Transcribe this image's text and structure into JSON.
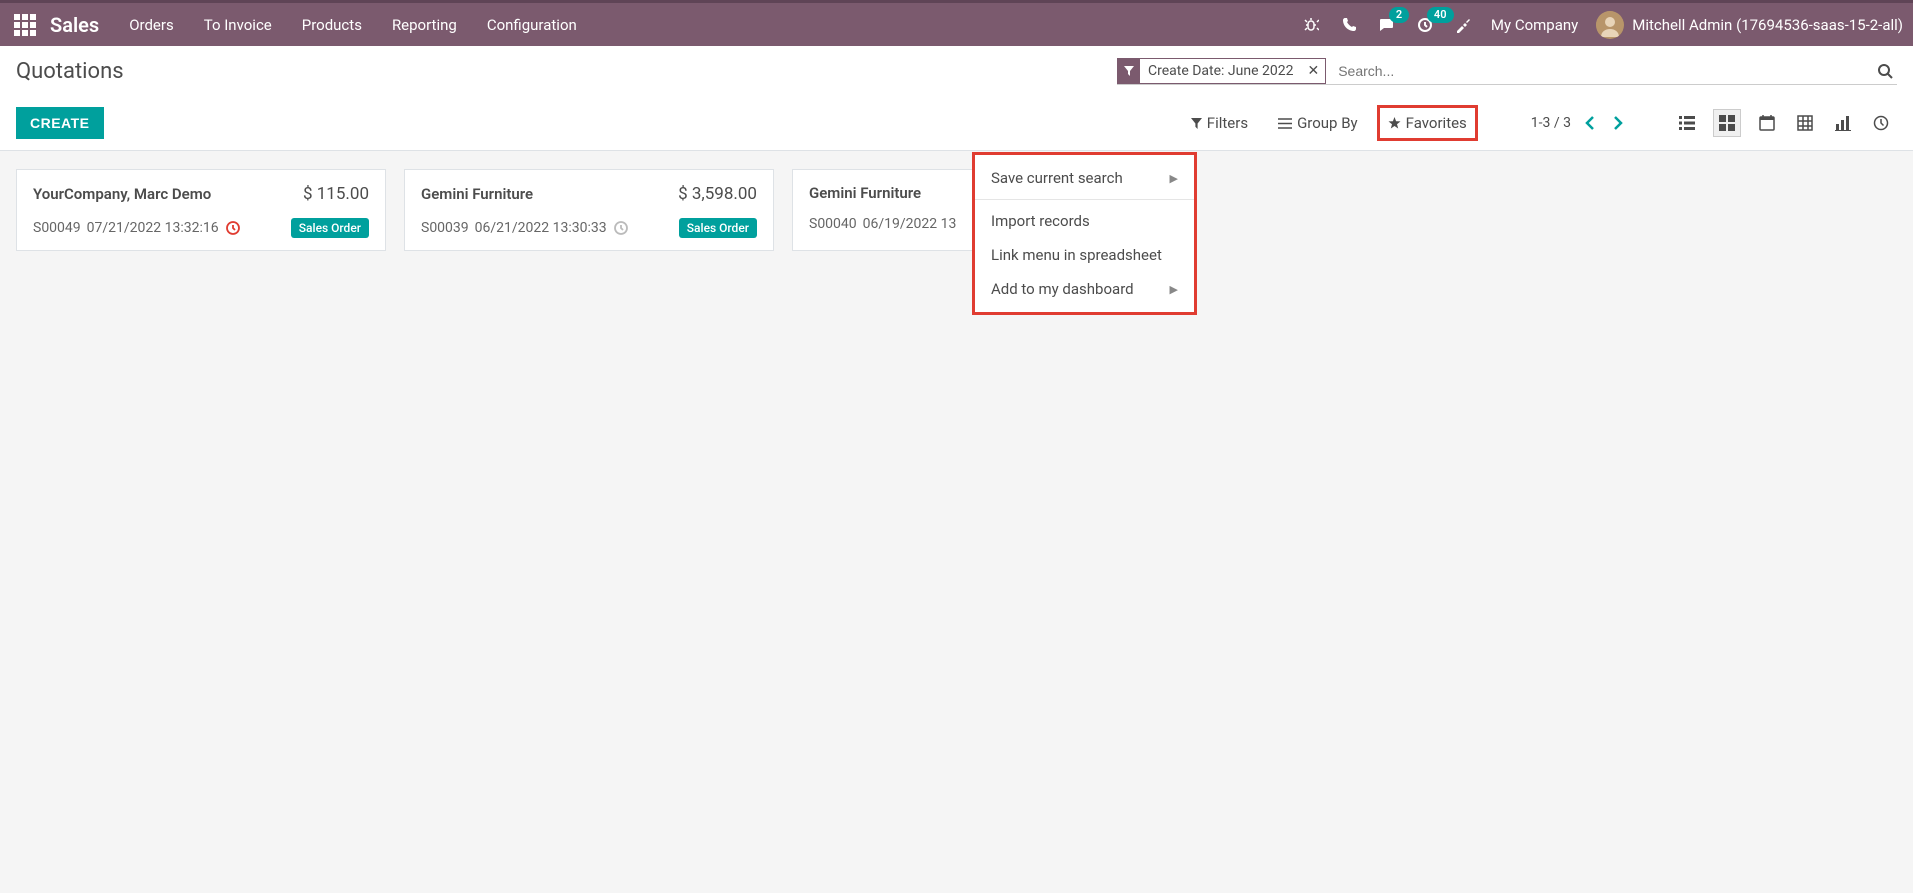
{
  "nav": {
    "brand": "Sales",
    "menus": [
      "Orders",
      "To Invoice",
      "Products",
      "Reporting",
      "Configuration"
    ],
    "badges": {
      "chat": "2",
      "activity": "40"
    },
    "company": "My Company",
    "user": "Mitchell Admin (17694536-saas-15-2-all)"
  },
  "page": {
    "title": "Quotations",
    "create": "CREATE"
  },
  "search": {
    "facet_label": "Create Date: June 2022",
    "placeholder": "Search..."
  },
  "toolbar": {
    "filters": "Filters",
    "groupby": "Group By",
    "favorites": "Favorites",
    "pager": "1-3 / 3"
  },
  "favorites_menu": {
    "save": "Save current search",
    "import": "Import records",
    "link": "Link menu in spreadsheet",
    "dashboard": "Add to my dashboard"
  },
  "cards": [
    {
      "title": "YourCompany, Marc Demo",
      "price": "$ 115.00",
      "order": "S00049",
      "datetime": "07/21/2022 13:32:16",
      "clock": "red",
      "status": "Sales Order"
    },
    {
      "title": "Gemini Furniture",
      "price": "$ 3,598.00",
      "order": "S00039",
      "datetime": "06/21/2022 13:30:33",
      "clock": "grey",
      "status": "Sales Order"
    },
    {
      "title": "Gemini Furniture",
      "price": "",
      "order": "S00040",
      "datetime": "06/19/2022 13",
      "clock": "",
      "status": ""
    }
  ]
}
